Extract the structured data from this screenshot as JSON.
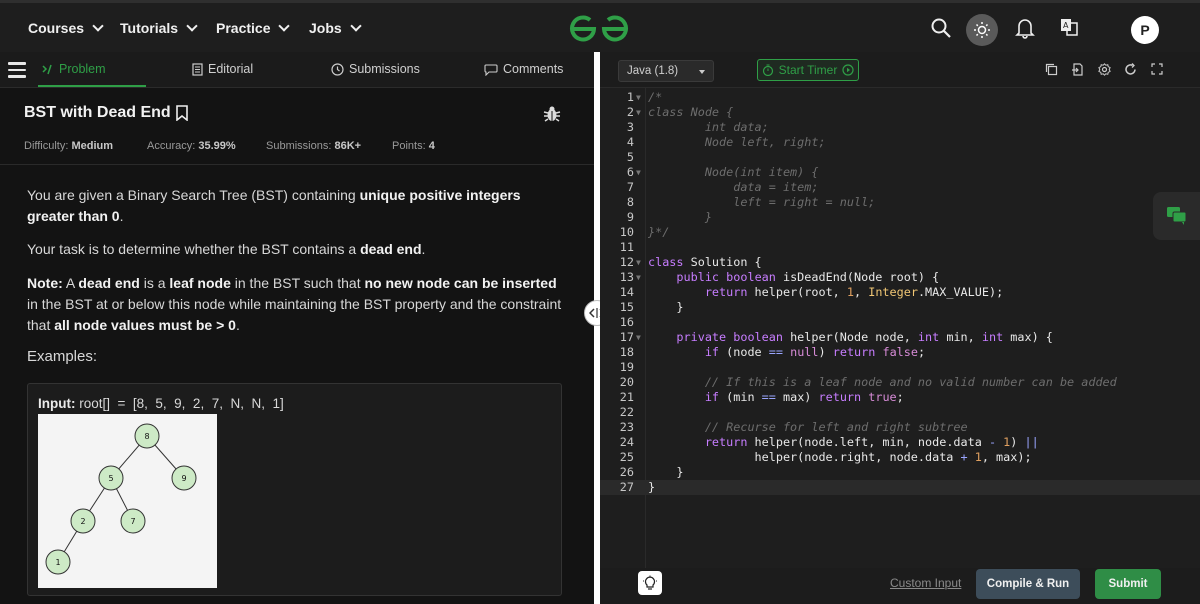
{
  "nav": {
    "items": [
      "Courses",
      "Tutorials",
      "Practice",
      "Jobs"
    ],
    "avatar_letter": "P"
  },
  "tabs": {
    "problem": "Problem",
    "editorial": "Editorial",
    "submissions": "Submissions",
    "comments": "Comments"
  },
  "problem": {
    "title": "BST with Dead End",
    "difficulty_label": "Difficulty:",
    "difficulty": "Medium",
    "accuracy_label": "Accuracy:",
    "accuracy": "35.99%",
    "submissions_label": "Submissions:",
    "submissions": "86K+",
    "points_label": "Points:",
    "points": "4",
    "p1_a": "You are given a Binary Search Tree (BST) containing ",
    "p1_b": "unique positive integers greater than 0",
    "p1_c": ".",
    "p2_a": "Your task is to determine whether the BST contains a ",
    "p2_b": "dead end",
    "p2_c": ".",
    "p3_note": "Note:",
    "p3_a": " A ",
    "p3_b": "dead end",
    "p3_c": " is a ",
    "p3_d": "leaf node",
    "p3_e": " in the BST such that ",
    "p3_f": "no new node can be inserted",
    "p3_g": " in the BST at or below this node while maintaining the BST property and the constraint that ",
    "p3_h": "all node values must be > 0",
    "p3_i": ".",
    "examples": "Examples:",
    "input_label": "Input:",
    "input_value": "root[]  =  [8,  5,  9,  2,  7,  N,  N,  1]",
    "tree_nodes": [
      "8",
      "5",
      "9",
      "2",
      "7",
      "1"
    ]
  },
  "editor": {
    "language": "Java (1.8)",
    "timer_label": "Start Timer",
    "custom_input": "Custom Input",
    "compile_run": "Compile & Run",
    "submit": "Submit"
  },
  "code_lines": [
    "/*",
    "class Node {",
    "        int data;",
    "        Node left, right;",
    "",
    "        Node(int item) {",
    "            data = item;",
    "            left = right = null;",
    "        }",
    "}*/",
    "",
    "class Solution {",
    "    public boolean isDeadEnd(Node root) {",
    "        return helper(root, 1, Integer.MAX_VALUE);",
    "    }",
    "",
    "    private boolean helper(Node node, int min, int max) {",
    "        if (node == null) return false;",
    "",
    "        // If this is a leaf node and no valid number can be added",
    "        if (min == max) return true;",
    "",
    "        // Recurse for left and right subtree",
    "        return helper(node.left, min, node.data - 1) ||",
    "               helper(node.right, node.data + 1, max);",
    "    }",
    "}"
  ]
}
